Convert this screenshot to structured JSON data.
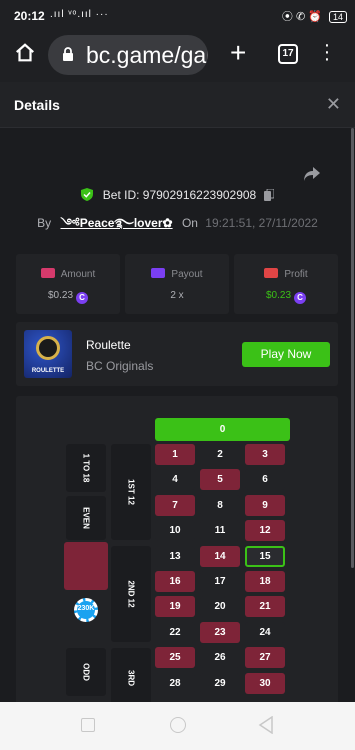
{
  "statusbar": {
    "time": "20:12",
    "signal": ".ııl ᵛᵒ.ııl ···",
    "icons": "⦿ ✆ ⏰",
    "battery": "14"
  },
  "browser": {
    "url": "bc.game/gar",
    "tab_count": "17",
    "plus": "+",
    "menu": "⋮"
  },
  "header": {
    "title": "Details",
    "close": "✕"
  },
  "bet": {
    "id_label": "Bet ID: 97902916223902908",
    "by_label": "By",
    "username": "༺Peace࿐lover✿",
    "on_label": "On",
    "timestamp": "19:21:51, 27/11/2022"
  },
  "stats": [
    {
      "label": "Amount",
      "value": "$0.23",
      "coin": "C",
      "color": "#d63a6c",
      "value_color": "#b0b1b6"
    },
    {
      "label": "Payout",
      "value": "2 x",
      "coin": "",
      "color": "#7b3ff2",
      "value_color": "#b0b1b6"
    },
    {
      "label": "Profit",
      "value": "$0.23",
      "coin": "C",
      "color": "#e04545",
      "value_color": "#3bc117"
    }
  ],
  "game": {
    "name": "Roulette",
    "provider": "BC Originals",
    "thumb_title": "ROULETTE",
    "play_label": "Play Now"
  },
  "board": {
    "zero": "0",
    "numbers": [
      [
        "1",
        "2",
        "3"
      ],
      [
        "4",
        "5",
        "6"
      ],
      [
        "7",
        "8",
        "9"
      ],
      [
        "10",
        "11",
        "12"
      ],
      [
        "13",
        "14",
        "15"
      ],
      [
        "16",
        "17",
        "18"
      ],
      [
        "19",
        "20",
        "21"
      ],
      [
        "22",
        "23",
        "24"
      ],
      [
        "25",
        "26",
        "27"
      ],
      [
        "28",
        "29",
        "30"
      ]
    ],
    "reds": [
      "1",
      "3",
      "5",
      "7",
      "9",
      "12",
      "14",
      "16",
      "18",
      "19",
      "21",
      "23",
      "25",
      "27",
      "30"
    ],
    "selected": "15",
    "outside": {
      "low": "1 TO 18",
      "even": "EVEN",
      "odd": "ODD",
      "dozen1": "1ST 12",
      "dozen2": "2ND 12",
      "dozen3": "3RD"
    },
    "chip_label": "230K"
  },
  "colors": {
    "accent": "#3bc117",
    "red": "#7e2438",
    "bg": "#1b1c1f"
  }
}
